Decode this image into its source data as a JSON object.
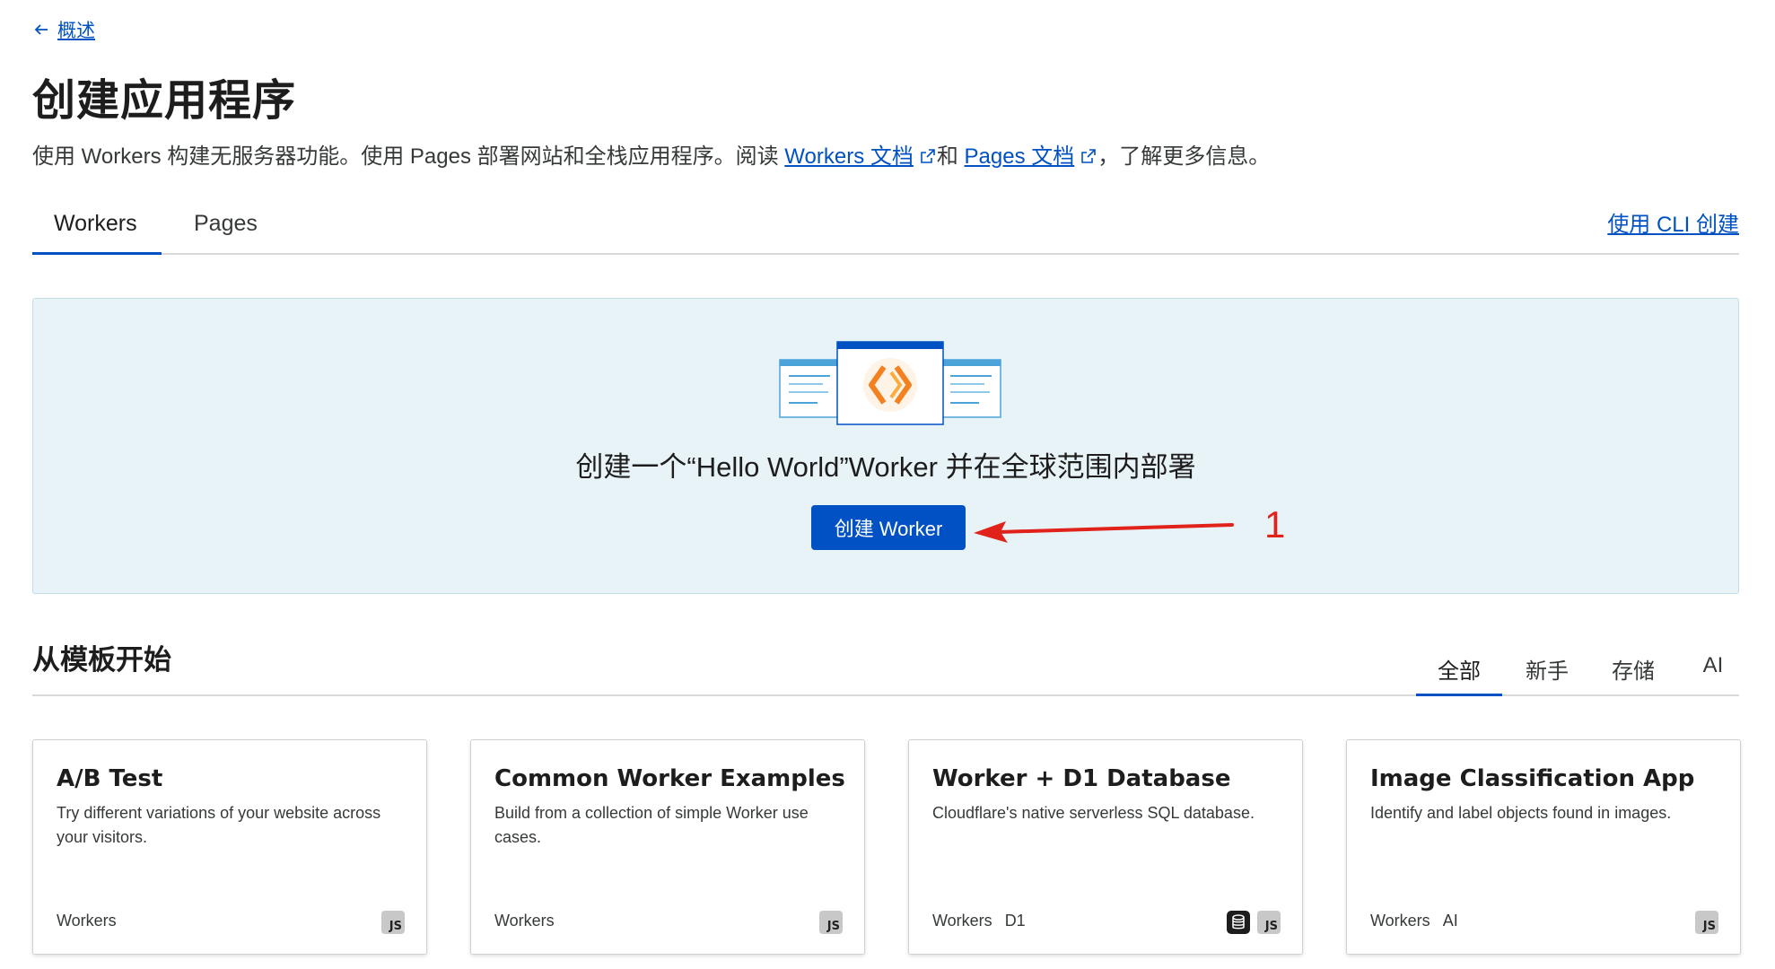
{
  "breadcrumb": {
    "back_label": "概述"
  },
  "page": {
    "title": "创建应用程序",
    "desc_prefix": "使用 Workers 构建无服务器功能。使用 Pages 部署网站和全栈应用程序。阅读 ",
    "workers_docs_link": "Workers 文档",
    "desc_and": "和 ",
    "pages_docs_link": "Pages 文档",
    "desc_suffix": "，了解更多信息。"
  },
  "tabs": [
    {
      "label": "Workers",
      "active": true
    },
    {
      "label": "Pages",
      "active": false
    }
  ],
  "cli_link": "使用 CLI 创建",
  "hero": {
    "text": "创建一个“Hello World”Worker 并在全球范围内部署",
    "button_label": "创建 Worker",
    "annotation_number": "1",
    "annotation_color": "#e0221b"
  },
  "templates": {
    "title": "从模板开始",
    "filters": [
      {
        "label": "全部",
        "active": true
      },
      {
        "label": "新手",
        "active": false
      },
      {
        "label": "存储",
        "active": false
      },
      {
        "label": "AI",
        "active": false
      }
    ],
    "cards": [
      {
        "title": "A/B Test",
        "desc": "Try different variations of your website across your visitors.",
        "tags": [
          "Workers"
        ],
        "icons": [
          "js-icon"
        ]
      },
      {
        "title": "Common Worker Examples",
        "desc": "Build from a collection of simple Worker use cases.",
        "tags": [
          "Workers"
        ],
        "icons": [
          "js-icon"
        ]
      },
      {
        "title": "Worker + D1 Database",
        "desc": "Cloudflare's native serverless SQL database.",
        "tags": [
          "Workers",
          "D1"
        ],
        "icons": [
          "database-icon",
          "js-icon"
        ]
      },
      {
        "title": "Image Classification App",
        "desc": "Identify and label objects found in images.",
        "tags": [
          "Workers",
          "AI"
        ],
        "icons": [
          "js-icon"
        ]
      }
    ],
    "js_badge_text": "JS"
  },
  "colors": {
    "accent": "#0051c3",
    "hero_bg": "#e8f3f8",
    "annotation": "#e0221b"
  }
}
